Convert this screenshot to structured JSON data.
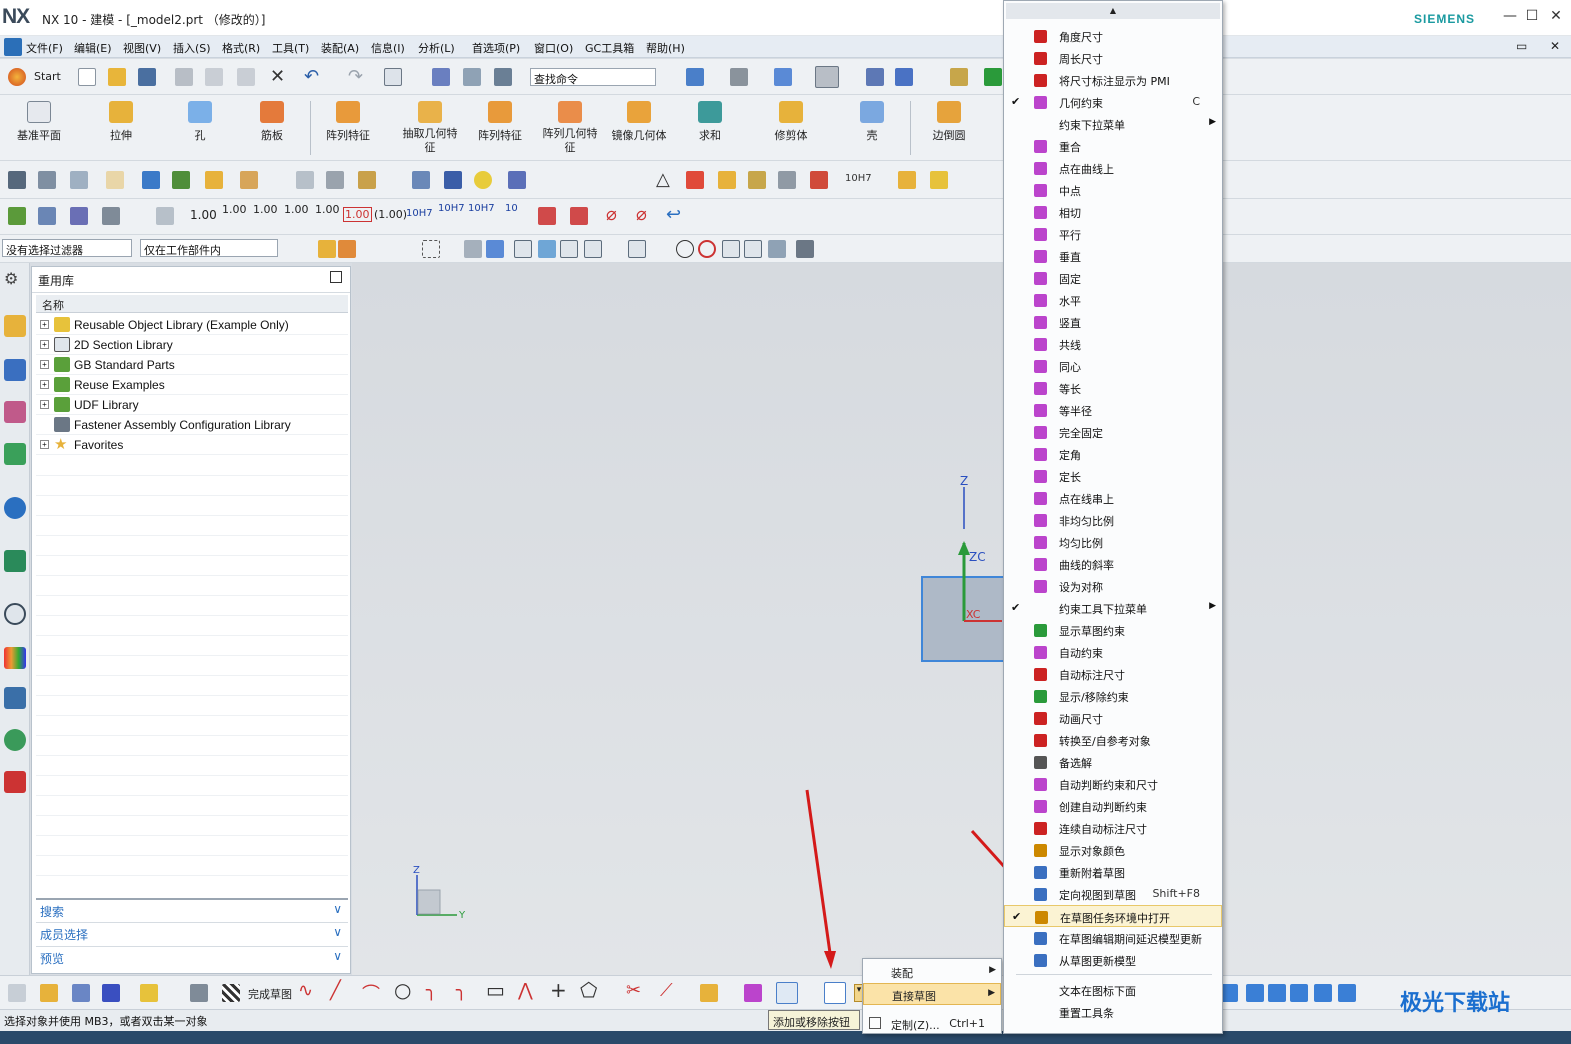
{
  "app": {
    "logo": "NX",
    "title": "NX 10 - 建模 - [_model2.prt （修改的）]",
    "brand": "SIEMENS",
    "minimize_icon": "—",
    "maximize_icon": "☐",
    "close_icon": "✕"
  },
  "menubar": [
    "文件(F)",
    "编辑(E)",
    "视图(V)",
    "插入(S)",
    "格式(R)",
    "工具(T)",
    "装配(A)",
    "信息(I)",
    "分析(L)",
    "首选项(P)",
    "窗口(O)",
    "GC工具箱",
    "帮助(H)"
  ],
  "toolbar1": {
    "start": "Start",
    "find_command_placeholder": "查找命令"
  },
  "feature_toolbar": [
    "基准平面",
    "拉伸",
    "孔",
    "筋板",
    "阵列特征",
    "抽取几何特征",
    "阵列特征",
    "阵列几何特征",
    "镜像几何体",
    "求和",
    "修剪体",
    "壳",
    "边倒圆"
  ],
  "dim_toolbar": [
    "1.00",
    "1.00",
    "1.00",
    "1.00",
    "1.00",
    "1.00",
    "(1.00)",
    "10H7",
    "10H7",
    "10H7",
    "10"
  ],
  "selection_bar": {
    "filter": "没有选择过滤器",
    "scope": "仅在工作部件内"
  },
  "panel": {
    "title": "重用库",
    "column": "名称",
    "items": [
      "Reusable Object Library (Example Only)",
      "2D Section Library",
      "GB Standard Parts",
      "Reuse Examples",
      "UDF Library",
      "Fastener Assembly Configuration Library",
      "Favorites"
    ],
    "sections": [
      "搜索",
      "成员选择",
      "预览"
    ]
  },
  "bottom_toolbar": {
    "finish_sketch": "完成草图"
  },
  "status_text": "选择对象并使用 MB3，或者双击某一对象",
  "tooltip": "添加或移除按钮",
  "context_menu": [
    {
      "label": "角度尺寸",
      "color": "#c22"
    },
    {
      "label": "周长尺寸",
      "color": "#c22"
    },
    {
      "label": "将尺寸标注显示为 PMI",
      "color": "#c22"
    },
    {
      "label": "几何约束",
      "shortcut": "C",
      "checked": true,
      "color": "#b4c"
    },
    {
      "label": "约束下拉菜单",
      "submenu": true
    },
    {
      "label": "重合",
      "color": "#b4c"
    },
    {
      "label": "点在曲线上",
      "color": "#b4c"
    },
    {
      "label": "中点",
      "color": "#b4c"
    },
    {
      "label": "相切",
      "color": "#b4c"
    },
    {
      "label": "平行",
      "color": "#b4c"
    },
    {
      "label": "垂直",
      "color": "#b4c"
    },
    {
      "label": "固定",
      "color": "#b4c"
    },
    {
      "label": "水平",
      "color": "#b4c"
    },
    {
      "label": "竖直",
      "color": "#b4c"
    },
    {
      "label": "共线",
      "color": "#b4c"
    },
    {
      "label": "同心",
      "color": "#b4c"
    },
    {
      "label": "等长",
      "color": "#b4c"
    },
    {
      "label": "等半径",
      "color": "#b4c"
    },
    {
      "label": "完全固定",
      "color": "#b4c"
    },
    {
      "label": "定角",
      "color": "#b4c"
    },
    {
      "label": "定长",
      "color": "#b4c"
    },
    {
      "label": "点在线串上",
      "color": "#b4c"
    },
    {
      "label": "非均匀比例",
      "color": "#b4c"
    },
    {
      "label": "均匀比例",
      "color": "#b4c"
    },
    {
      "label": "曲线的斜率",
      "color": "#b4c"
    },
    {
      "label": "设为对称",
      "color": "#b4c"
    },
    {
      "label": "约束工具下拉菜单",
      "checked": true,
      "submenu": true
    },
    {
      "label": "显示草图约束",
      "color": "#2a9a3a"
    },
    {
      "label": "自动约束",
      "color": "#b4c"
    },
    {
      "label": "自动标注尺寸",
      "color": "#c22"
    },
    {
      "label": "显示/移除约束",
      "color": "#2a9a3a"
    },
    {
      "label": "动画尺寸",
      "color": "#c22"
    },
    {
      "label": "转换至/自参考对象",
      "color": "#c22"
    },
    {
      "label": "备选解",
      "color": "#555"
    },
    {
      "label": "自动判断约束和尺寸",
      "color": "#b4c"
    },
    {
      "label": "创建自动判断约束",
      "color": "#b4c"
    },
    {
      "label": "连续自动标注尺寸",
      "color": "#c22"
    },
    {
      "label": "显示对象颜色",
      "color": "#c80"
    },
    {
      "label": "重新附着草图",
      "color": "#3a6fc0"
    },
    {
      "label": "定向视图到草图",
      "shortcut": "Shift+F8",
      "color": "#3a6fc0"
    },
    {
      "label": "在草图任务环境中打开",
      "checked": true,
      "highlight": true,
      "color": "#c80"
    },
    {
      "label": "在草图编辑期间延迟模型更新",
      "color": "#3a6fc0"
    },
    {
      "label": "从草图更新模型",
      "color": "#3a6fc0"
    },
    {
      "label": "文本在图标下面"
    },
    {
      "label": "重置工具条"
    }
  ],
  "submenu": [
    {
      "label": "装配",
      "submenu": true
    },
    {
      "label": "直接草图",
      "submenu": true,
      "highlight": true
    },
    {
      "label": "定制(Z)...",
      "shortcut": "Ctrl+1"
    }
  ],
  "watermark": "极光下载站"
}
